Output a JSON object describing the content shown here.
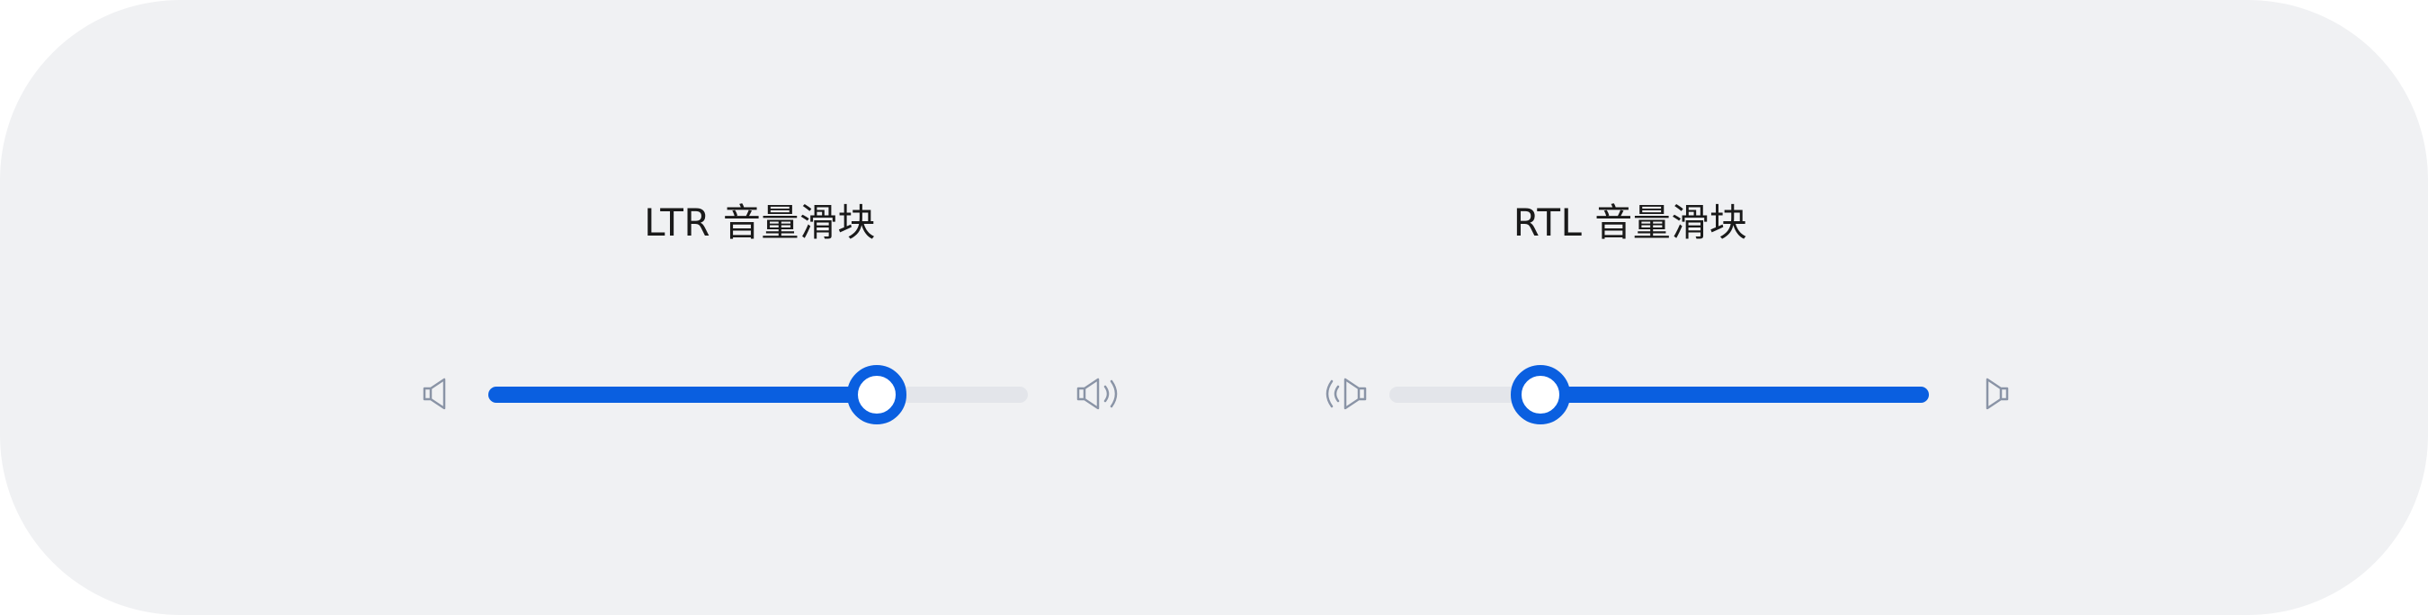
{
  "ltr_slider": {
    "title": "LTR 音量滑块",
    "direction": "ltr",
    "value_fraction": 0.72,
    "min_icon": "speaker-mute-icon",
    "max_icon": "speaker-loud-icon"
  },
  "rtl_slider": {
    "title": "RTL 音量滑块",
    "direction": "rtl",
    "value_fraction": 0.72,
    "min_icon": "speaker-mute-icon",
    "max_icon": "speaker-loud-icon"
  },
  "colors": {
    "background": "#f0f1f3",
    "accent": "#0a5fe0",
    "track": "#e3e5ea",
    "icon": "#8a94a6",
    "text": "#1a1a1a"
  }
}
